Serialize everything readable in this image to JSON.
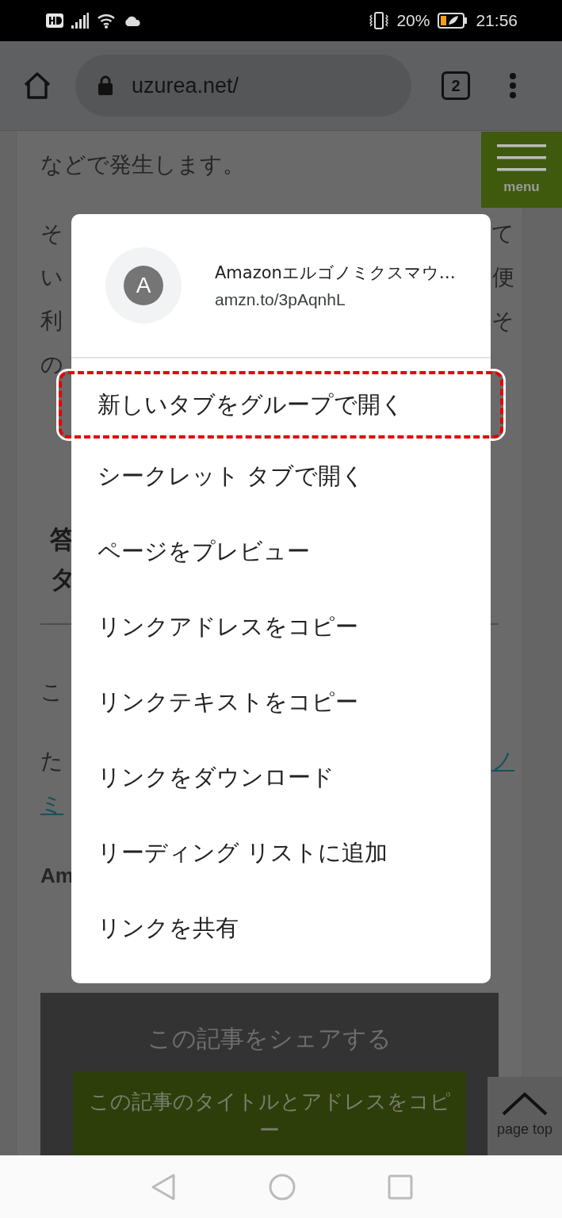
{
  "status_bar": {
    "battery": "20%",
    "time": "21:56"
  },
  "toolbar": {
    "url": "uzurea.net/",
    "tab_count": "2"
  },
  "menu_button": {
    "label": "menu"
  },
  "article": {
    "blocks": [
      {
        "kind": "text",
        "lines": [
          {
            "left": "などで発生します。"
          }
        ]
      },
      {
        "kind": "text",
        "lines": [
          {
            "left": "そ",
            "right": "て"
          },
          {
            "left": "い",
            "right": "便"
          },
          {
            "left": "利",
            "right": "そ"
          },
          {
            "left": "の"
          }
        ]
      },
      {
        "kind": "heading",
        "lines": [
          {
            "left": "答"
          },
          {
            "left": "タ"
          }
        ]
      },
      {
        "kind": "rule"
      },
      {
        "kind": "text",
        "lines": [
          {
            "left": "こ"
          }
        ]
      },
      {
        "kind": "text",
        "lines": [
          {
            "left": "た",
            "right": "ノ",
            "right_link": true
          },
          {
            "left": "ミ",
            "left_link": true
          }
        ]
      },
      {
        "kind": "bold",
        "lines": [
          {
            "left": "Am"
          }
        ]
      }
    ]
  },
  "share": {
    "title": "この記事をシェアする",
    "button": "この記事のタイトルとアドレスをコピー"
  },
  "page_top": {
    "label": "page top"
  },
  "dialog": {
    "avatar": "A",
    "title": "Amazonエルゴノミクスマウ…",
    "url": "amzn.to/3pAqnhL",
    "items": [
      {
        "label": "新しいタブをグループで開く",
        "highlighted": true
      },
      {
        "label": "シークレット タブで開く",
        "highlighted": false
      },
      {
        "label": "ページをプレビュー",
        "highlighted": false
      },
      {
        "label": "リンクアドレスをコピー",
        "highlighted": false
      },
      {
        "label": "リンクテキストをコピー",
        "highlighted": false
      },
      {
        "label": "リンクをダウンロード",
        "highlighted": false
      },
      {
        "label": "リーディング リストに追加",
        "highlighted": false
      },
      {
        "label": "リンクを共有",
        "highlighted": false
      }
    ]
  }
}
